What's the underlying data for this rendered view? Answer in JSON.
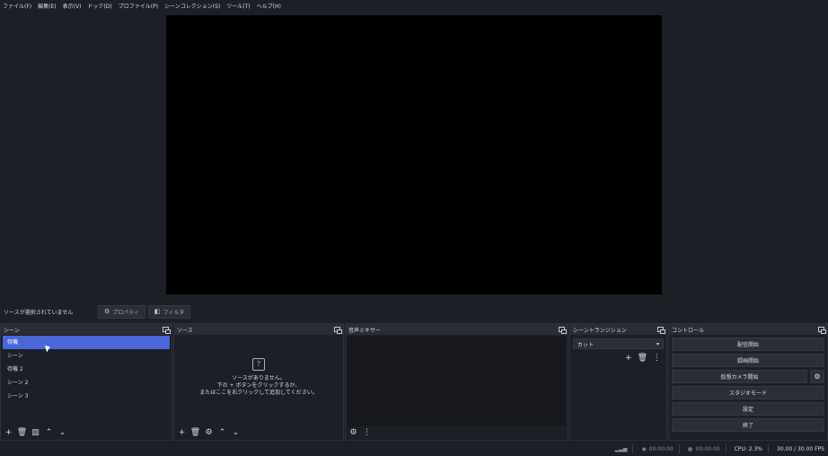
{
  "menu": [
    "ファイル(F)",
    "編集(E)",
    "表示(V)",
    "ドック(D)",
    "プロファイル(P)",
    "シーンコレクション(S)",
    "ツール(T)",
    "ヘルプ(H)"
  ],
  "source_bar": {
    "status": "ソースが選択されていません",
    "properties_label": "プロパティ",
    "filters_label": "フィルタ"
  },
  "scenes": {
    "title": "シーン",
    "items": [
      "待機",
      "シーン",
      "待機 2",
      "シーン 2",
      "シーン 3"
    ],
    "selected_index": 0
  },
  "sources": {
    "title": "ソース",
    "empty_lines": [
      "ソースがありません。",
      "下の + ボタンをクリックするか、",
      "またはここを右クリックして追加してください。"
    ]
  },
  "mixer": {
    "title": "音声ミキサー"
  },
  "transitions": {
    "title": "シーントランジション",
    "selected": "カット"
  },
  "controls": {
    "title": "コントロール",
    "start_streaming": "配信開始",
    "start_recording": "録画開始",
    "start_virtualcam": "仮想カメラ開始",
    "studio_mode": "スタジオモード",
    "settings": "設定",
    "exit": "終了"
  },
  "status": {
    "stream_time": "00:00:00",
    "record_time": "00:00:00",
    "cpu": "CPU: 2.3%",
    "fps": "30.00 / 30.00 FPS"
  },
  "colors": {
    "background": "#1d1f26",
    "panel_header": "#2a2d36",
    "selection": "#4967d9",
    "button": "#2b2e38"
  }
}
